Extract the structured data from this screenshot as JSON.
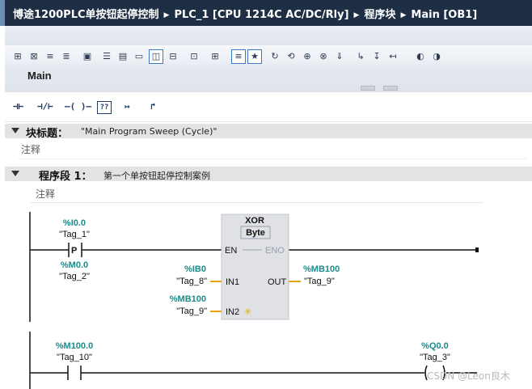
{
  "breadcrumb": {
    "project": "博途1200PLC单按钮起停控制",
    "device": "PLC_1 [CPU 1214C AC/DC/Rly]",
    "folder": "程序块",
    "block": "Main [OB1]"
  },
  "editor": {
    "block_name": "Main"
  },
  "instructions": [
    "⊣⊢",
    "⊣/⊢",
    "–( )–",
    "??",
    "↦",
    "↱"
  ],
  "block_title": {
    "label": "块标题：",
    "value": "\"Main Program Sweep (Cycle)\"",
    "comment": "注释"
  },
  "network": {
    "label": "程序段 1：",
    "title": "第一个单按钮起停控制案例",
    "comment": "注释"
  },
  "ladder": {
    "contact_p": {
      "address": "%I0.0",
      "tag": "\"Tag_1\"",
      "letter": "P",
      "edge_address": "%M0.0",
      "edge_tag": "\"Tag_2\""
    },
    "xor_box": {
      "name": "XOR",
      "type": "Byte",
      "en": "EN",
      "eno": "ENO",
      "in1": "IN1",
      "in2": "IN2",
      "out": "OUT"
    },
    "in1": {
      "address": "%IB0",
      "tag": "\"Tag_8\""
    },
    "in2": {
      "address": "%MB100",
      "tag": "\"Tag_9\""
    },
    "out": {
      "address": "%MB100",
      "tag": "\"Tag_9\""
    },
    "contact2": {
      "address": "%M100.0",
      "tag": "\"Tag_10\""
    },
    "coil": {
      "address": "%Q0.0",
      "tag": "\"Tag_3\""
    }
  },
  "watermark": "CSDN @Leon良木"
}
